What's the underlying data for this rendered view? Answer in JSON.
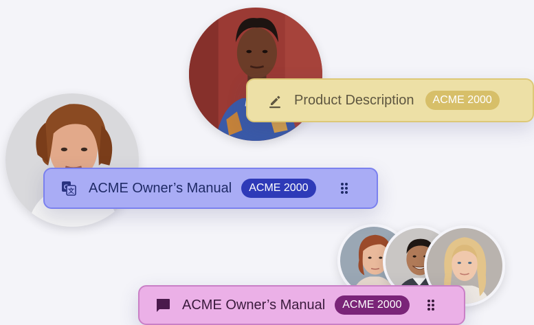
{
  "avatars": [
    {
      "name": "avatar-woman-red-wall"
    },
    {
      "name": "avatar-man-curly-hair"
    },
    {
      "name": "avatar-woman-red-hair"
    },
    {
      "name": "avatar-man-smiling"
    },
    {
      "name": "avatar-woman-blonde"
    }
  ],
  "cards": {
    "product": {
      "label": "Product Description",
      "badge": "ACME 2000",
      "icon": "pen-icon",
      "color": "#ede0a6"
    },
    "manual_blue": {
      "label": "ACME Owner’s Manual",
      "badge": "ACME 2000",
      "icon": "translate-icon",
      "color": "#a9acf5"
    },
    "manual_pink": {
      "label": "ACME Owner’s Manual",
      "badge": "ACME 2000",
      "icon": "chat-bubble-icon",
      "color": "#ebb0e7"
    }
  }
}
